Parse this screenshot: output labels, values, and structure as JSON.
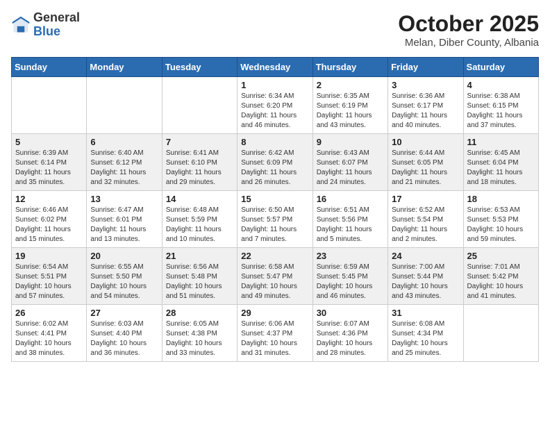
{
  "header": {
    "logo": {
      "general": "General",
      "blue": "Blue"
    },
    "title": "October 2025",
    "subtitle": "Melan, Diber County, Albania"
  },
  "weekdays": [
    "Sunday",
    "Monday",
    "Tuesday",
    "Wednesday",
    "Thursday",
    "Friday",
    "Saturday"
  ],
  "weeks": [
    [
      {
        "day": null
      },
      {
        "day": null
      },
      {
        "day": null
      },
      {
        "day": "1",
        "sunrise": "6:34 AM",
        "sunset": "6:20 PM",
        "daylight": "11 hours and 46 minutes."
      },
      {
        "day": "2",
        "sunrise": "6:35 AM",
        "sunset": "6:19 PM",
        "daylight": "11 hours and 43 minutes."
      },
      {
        "day": "3",
        "sunrise": "6:36 AM",
        "sunset": "6:17 PM",
        "daylight": "11 hours and 40 minutes."
      },
      {
        "day": "4",
        "sunrise": "6:38 AM",
        "sunset": "6:15 PM",
        "daylight": "11 hours and 37 minutes."
      }
    ],
    [
      {
        "day": "5",
        "sunrise": "6:39 AM",
        "sunset": "6:14 PM",
        "daylight": "11 hours and 35 minutes."
      },
      {
        "day": "6",
        "sunrise": "6:40 AM",
        "sunset": "6:12 PM",
        "daylight": "11 hours and 32 minutes."
      },
      {
        "day": "7",
        "sunrise": "6:41 AM",
        "sunset": "6:10 PM",
        "daylight": "11 hours and 29 minutes."
      },
      {
        "day": "8",
        "sunrise": "6:42 AM",
        "sunset": "6:09 PM",
        "daylight": "11 hours and 26 minutes."
      },
      {
        "day": "9",
        "sunrise": "6:43 AM",
        "sunset": "6:07 PM",
        "daylight": "11 hours and 24 minutes."
      },
      {
        "day": "10",
        "sunrise": "6:44 AM",
        "sunset": "6:05 PM",
        "daylight": "11 hours and 21 minutes."
      },
      {
        "day": "11",
        "sunrise": "6:45 AM",
        "sunset": "6:04 PM",
        "daylight": "11 hours and 18 minutes."
      }
    ],
    [
      {
        "day": "12",
        "sunrise": "6:46 AM",
        "sunset": "6:02 PM",
        "daylight": "11 hours and 15 minutes."
      },
      {
        "day": "13",
        "sunrise": "6:47 AM",
        "sunset": "6:01 PM",
        "daylight": "11 hours and 13 minutes."
      },
      {
        "day": "14",
        "sunrise": "6:48 AM",
        "sunset": "5:59 PM",
        "daylight": "11 hours and 10 minutes."
      },
      {
        "day": "15",
        "sunrise": "6:50 AM",
        "sunset": "5:57 PM",
        "daylight": "11 hours and 7 minutes."
      },
      {
        "day": "16",
        "sunrise": "6:51 AM",
        "sunset": "5:56 PM",
        "daylight": "11 hours and 5 minutes."
      },
      {
        "day": "17",
        "sunrise": "6:52 AM",
        "sunset": "5:54 PM",
        "daylight": "11 hours and 2 minutes."
      },
      {
        "day": "18",
        "sunrise": "6:53 AM",
        "sunset": "5:53 PM",
        "daylight": "10 hours and 59 minutes."
      }
    ],
    [
      {
        "day": "19",
        "sunrise": "6:54 AM",
        "sunset": "5:51 PM",
        "daylight": "10 hours and 57 minutes."
      },
      {
        "day": "20",
        "sunrise": "6:55 AM",
        "sunset": "5:50 PM",
        "daylight": "10 hours and 54 minutes."
      },
      {
        "day": "21",
        "sunrise": "6:56 AM",
        "sunset": "5:48 PM",
        "daylight": "10 hours and 51 minutes."
      },
      {
        "day": "22",
        "sunrise": "6:58 AM",
        "sunset": "5:47 PM",
        "daylight": "10 hours and 49 minutes."
      },
      {
        "day": "23",
        "sunrise": "6:59 AM",
        "sunset": "5:45 PM",
        "daylight": "10 hours and 46 minutes."
      },
      {
        "day": "24",
        "sunrise": "7:00 AM",
        "sunset": "5:44 PM",
        "daylight": "10 hours and 43 minutes."
      },
      {
        "day": "25",
        "sunrise": "7:01 AM",
        "sunset": "5:42 PM",
        "daylight": "10 hours and 41 minutes."
      }
    ],
    [
      {
        "day": "26",
        "sunrise": "6:02 AM",
        "sunset": "4:41 PM",
        "daylight": "10 hours and 38 minutes."
      },
      {
        "day": "27",
        "sunrise": "6:03 AM",
        "sunset": "4:40 PM",
        "daylight": "10 hours and 36 minutes."
      },
      {
        "day": "28",
        "sunrise": "6:05 AM",
        "sunset": "4:38 PM",
        "daylight": "10 hours and 33 minutes."
      },
      {
        "day": "29",
        "sunrise": "6:06 AM",
        "sunset": "4:37 PM",
        "daylight": "10 hours and 31 minutes."
      },
      {
        "day": "30",
        "sunrise": "6:07 AM",
        "sunset": "4:36 PM",
        "daylight": "10 hours and 28 minutes."
      },
      {
        "day": "31",
        "sunrise": "6:08 AM",
        "sunset": "4:34 PM",
        "daylight": "10 hours and 25 minutes."
      },
      {
        "day": null
      }
    ]
  ],
  "labels": {
    "sunrise_prefix": "Sunrise: ",
    "sunset_prefix": "Sunset: ",
    "daylight_prefix": "Daylight: "
  }
}
